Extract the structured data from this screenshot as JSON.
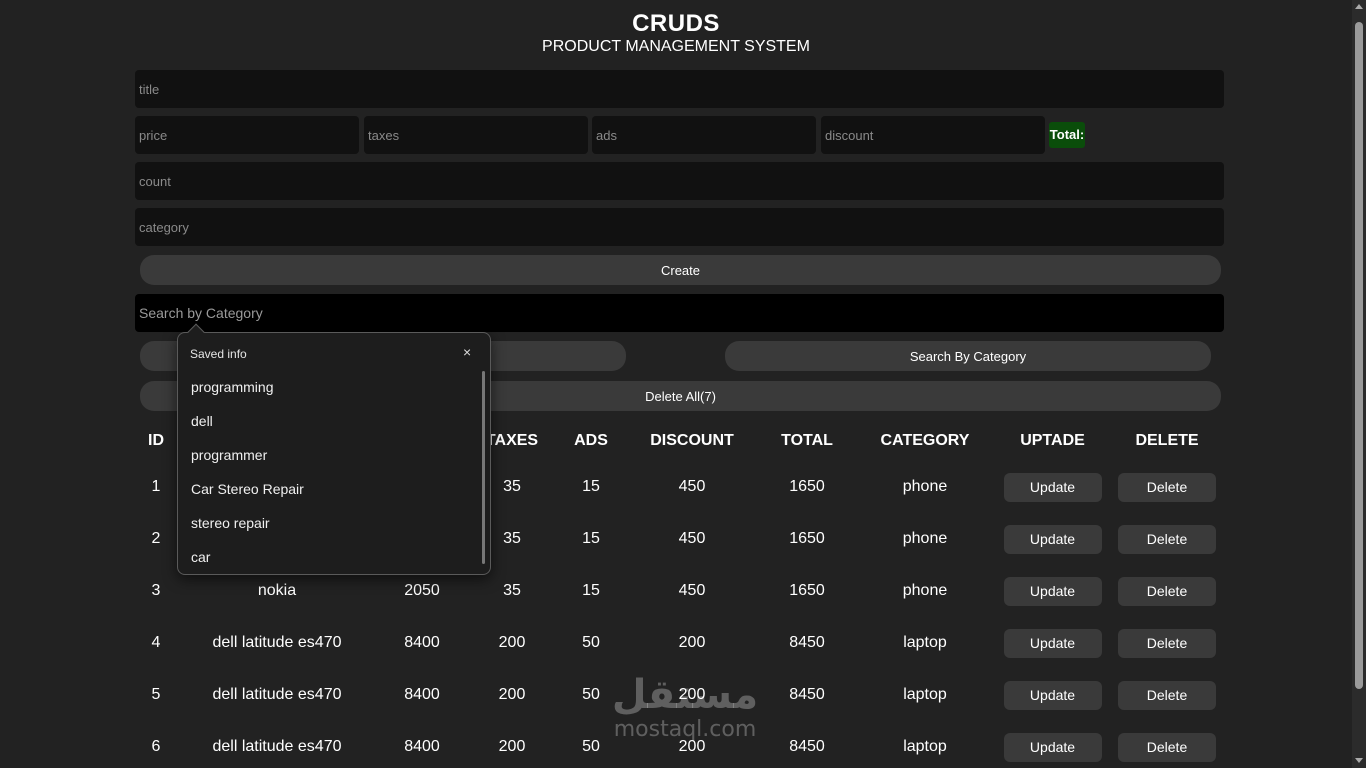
{
  "header": {
    "title": "CRUDS",
    "subtitle": "PRODUCT MANAGEMENT SYSTEM"
  },
  "form": {
    "title_placeholder": "title",
    "price_placeholder": "price",
    "taxes_placeholder": "taxes",
    "ads_placeholder": "ads",
    "discount_placeholder": "discount",
    "total_label": "Total:",
    "count_placeholder": "count",
    "category_placeholder": "category",
    "create_label": "Create"
  },
  "search": {
    "placeholder": "Search by Category",
    "by_category_label": "Search By Category",
    "delete_all_label": "Delete All(7)"
  },
  "saved_info": {
    "title": "Saved info",
    "close": "×",
    "items": [
      "programming",
      "dell",
      "programmer",
      "Car Stereo Repair",
      "stereo repair",
      "car"
    ]
  },
  "table": {
    "headers": [
      "ID",
      "",
      "",
      "TAXES",
      "ADS",
      "DISCOUNT",
      "TOTAL",
      "CATEGORY",
      "UPTADE",
      "DELETE"
    ],
    "update_label": "Update",
    "delete_label": "Delete",
    "rows": [
      {
        "id": "1",
        "title": "",
        "price": "",
        "taxes": "35",
        "ads": "15",
        "discount": "450",
        "total": "1650",
        "category": "phone"
      },
      {
        "id": "2",
        "title": "",
        "price": "",
        "taxes": "35",
        "ads": "15",
        "discount": "450",
        "total": "1650",
        "category": "phone"
      },
      {
        "id": "3",
        "title": "nokia",
        "price": "2050",
        "taxes": "35",
        "ads": "15",
        "discount": "450",
        "total": "1650",
        "category": "phone"
      },
      {
        "id": "4",
        "title": "dell latitude es470",
        "price": "8400",
        "taxes": "200",
        "ads": "50",
        "discount": "200",
        "total": "8450",
        "category": "laptop"
      },
      {
        "id": "5",
        "title": "dell latitude es470",
        "price": "8400",
        "taxes": "200",
        "ads": "50",
        "discount": "200",
        "total": "8450",
        "category": "laptop"
      },
      {
        "id": "6",
        "title": "dell latitude es470",
        "price": "8400",
        "taxes": "200",
        "ads": "50",
        "discount": "200",
        "total": "8450",
        "category": "laptop"
      }
    ]
  },
  "watermark": {
    "arabic": "مستقل",
    "latin": "mostaql.com"
  },
  "colors": {
    "background": "#222222",
    "field": "#111111",
    "button": "#3a3a3a",
    "total_badge": "#0a4d0a"
  }
}
